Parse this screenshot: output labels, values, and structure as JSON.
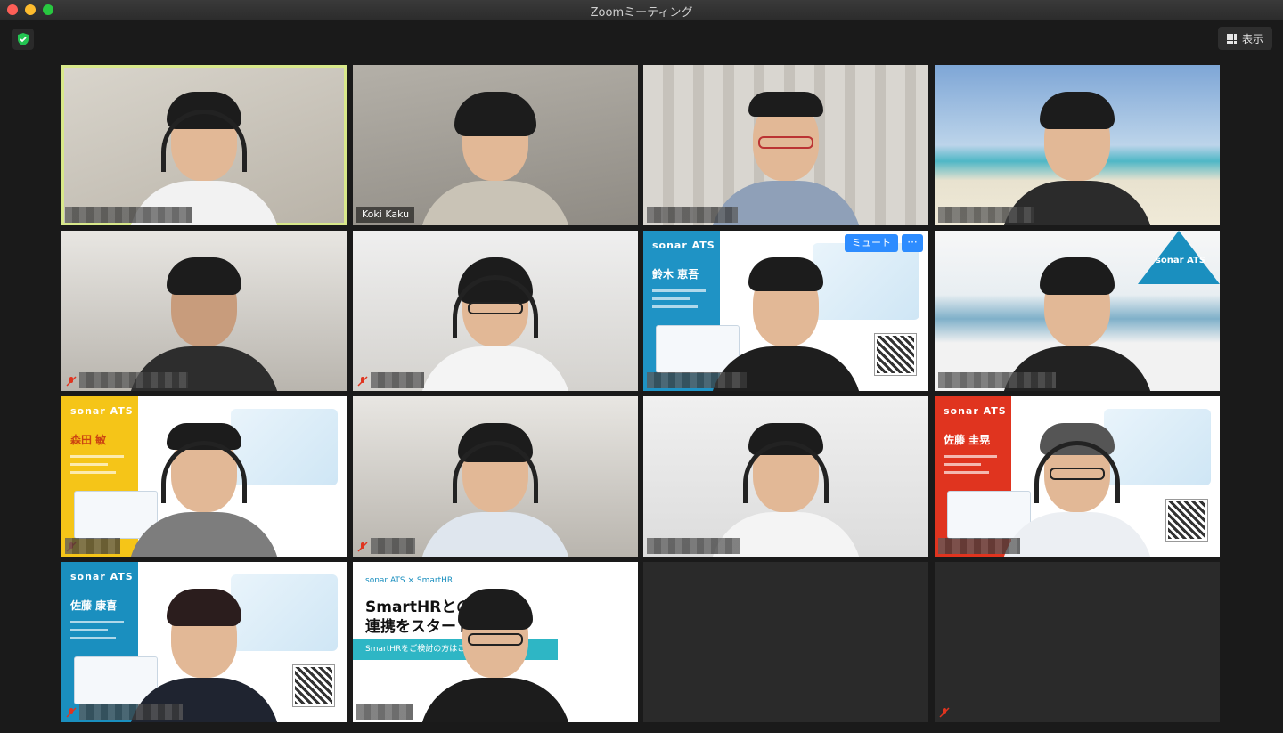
{
  "window": {
    "title": "Zoomミーティング"
  },
  "toolbar": {
    "view_label": "表示"
  },
  "tiles": [
    {
      "name_label": "",
      "speaking": true
    },
    {
      "name_label": "Koki Kaku"
    },
    {
      "name_label": ""
    },
    {
      "name_label": ""
    },
    {
      "name_label": "",
      "muted": true
    },
    {
      "name_label": "",
      "muted": true
    },
    {
      "name_label": "",
      "muted": false,
      "overlay": {
        "mute_button": "ミュート",
        "more_button": "···"
      },
      "slide": {
        "brand": "sonar ATS",
        "name": "鈴木 恵吾"
      }
    },
    {
      "name_label": "",
      "slide": {
        "brand": "sonar ATS"
      }
    },
    {
      "name_label": "",
      "muted": true,
      "slide": {
        "brand": "sonar ATS",
        "name": "森田 敏"
      }
    },
    {
      "name_label": "",
      "muted": true
    },
    {
      "name_label": ""
    },
    {
      "name_label": "",
      "slide": {
        "brand": "sonar ATS",
        "name": "佐藤 圭晃"
      }
    },
    {
      "name_label": "",
      "muted": true,
      "slide": {
        "brand": "sonar ATS",
        "name": "佐藤 康喜"
      }
    },
    {
      "name_label": "",
      "banner": {
        "header": "sonar ATS × SmartHR",
        "headline_1": "SmartHRとの",
        "headline_2": "連携をスタート",
        "cta": "SmartHRをご検討の方はこちら"
      }
    },
    {
      "empty": true
    },
    {
      "empty": true,
      "muted": true
    }
  ],
  "colors": {
    "active_border": "#d8e88a",
    "zoom_blue": "#2d8cff",
    "mute_red": "#e0341f"
  }
}
